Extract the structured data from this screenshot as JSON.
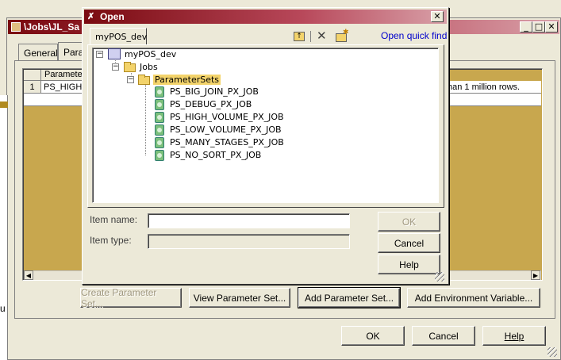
{
  "background_window": {
    "title": "\\Jobs\\JL_Sa",
    "tabs": [
      "General",
      "Para"
    ],
    "grid_header": "Paramete",
    "row_number": "1",
    "row_value": "PS_HIGH",
    "row_description": "han 1 million rows.",
    "left_clip_char": "u",
    "buttons": {
      "create": "Create Parameter Set...",
      "view": "View Parameter Set...",
      "add": "Add Parameter Set...",
      "add_env": "Add Environment Variable...",
      "ok": "OK",
      "cancel": "Cancel",
      "help": "Help"
    }
  },
  "open_dialog": {
    "title": "Open",
    "tab": "myPOS_dev",
    "quick_find": "Open quick find",
    "tree": {
      "root": "myPOS_dev",
      "jobs": "Jobs",
      "parameter_sets": "ParameterSets",
      "items": [
        "PS_BIG_JOIN_PX_JOB",
        "PS_DEBUG_PX_JOB",
        "PS_HIGH_VOLUME_PX_JOB",
        "PS_LOW_VOLUME_PX_JOB",
        "PS_MANY_STAGES_PX_JOB",
        "PS_NO_SORT_PX_JOB"
      ]
    },
    "item_name_label": "Item name:",
    "item_name_value": "",
    "item_type_label": "Item type:",
    "item_type_value": "",
    "buttons": {
      "ok": "OK",
      "cancel": "Cancel",
      "help": "Help"
    }
  },
  "colors": {
    "titlebar": "#7a0a10",
    "grid_fill": "#c8a74e",
    "tree_link": "#0000cc"
  }
}
